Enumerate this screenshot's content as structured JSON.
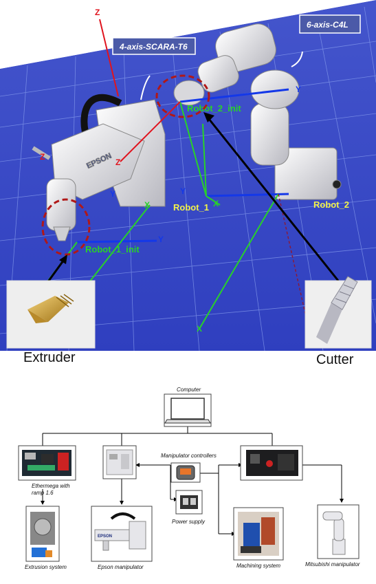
{
  "scene": {
    "labels": {
      "scara_callout": "4-axis-SCARA-T6",
      "six_axis_callout": "6-axis-C4L",
      "robot1": "Robot_1",
      "robot2": "Robot_2",
      "robot1_init": "Robot_1_init",
      "robot2_init": "Robot_2_init",
      "axis_z": "Z",
      "axis_y": "Y",
      "axis_x": "X",
      "epson_brand": "EPSON"
    },
    "tools": {
      "extruder": "Extruder",
      "cutter": "Cutter"
    },
    "colors": {
      "floor": "#3a4fd0",
      "sky": "#ffffff",
      "axis_z": "#e0141e",
      "axis_y": "#1438e8",
      "axis_x": "#28d228",
      "label_yellow": "#f2f24a",
      "highlight": "#b01818"
    }
  },
  "diagram": {
    "computer": "Computer",
    "board": "Ethermega with ramp 1.6",
    "controllers": "Manipulator controllers",
    "power_supply": "Power supply",
    "extrusion_system": "Extrusion system",
    "epson_manipulator": "Epson manipulator",
    "machining_system": "Machining system",
    "mitsubishi_manipulator": "Mitsubishi manipulator"
  }
}
